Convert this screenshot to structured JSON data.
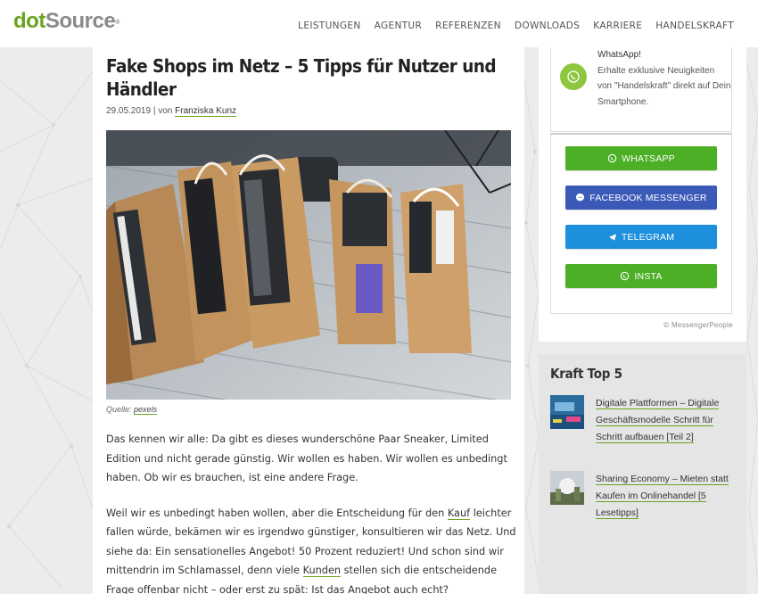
{
  "header": {
    "logo_part1": "dot",
    "logo_part2": "Source",
    "nav": [
      "LEISTUNGEN",
      "AGENTUR",
      "REFERENZEN",
      "DOWNLOADS",
      "KARRIERE",
      "HANDELSKRAFT"
    ]
  },
  "article": {
    "title": "Fake Shops im Netz – 5 Tipps für Nutzer und Händler",
    "date": "29.05.2019",
    "by": "| von",
    "author": "Franziska Kunz",
    "caption_prefix": "Quelle:",
    "caption_link": "pexels",
    "p1": "Das kennen wir alle: Da gibt es dieses wunderschöne Paar Sneaker, Limited Edition und nicht gerade günstig. Wir wollen es haben. Wir wollen es unbedingt haben. Ob wir es brauchen, ist eine andere Frage.",
    "p2_a": "Weil wir es unbedingt haben wollen, aber die Entscheidung für den ",
    "p2_link1": "Kauf",
    "p2_b": " leichter fallen würde, bekämen wir es irgendwo günstiger, konsultieren wir das Netz. Und siehe da: Ein sensationelles Angebot! 50 Prozent reduziert! Und schon sind wir mittendrin im Schlamassel, denn viele ",
    "p2_link2": "Kunden",
    "p2_c": " stellen sich die entscheidende Frage offenbar nicht – oder erst zu spät: Ist das Angebot auch echt?"
  },
  "widget": {
    "line1": "WhatsApp!",
    "line2": "Erhalte exklusive Neuigkeiten von \"Handelskraft\" direkt auf Dein Smartphone.",
    "buttons": [
      {
        "label": "WHATSAPP",
        "color": "#4caf25",
        "icon": "whatsapp-icon"
      },
      {
        "label": "FACEBOOK MESSENGER",
        "color": "#3b5ab8",
        "icon": "messenger-icon"
      },
      {
        "label": "TELEGRAM",
        "color": "#1e8fdc",
        "icon": "telegram-icon"
      },
      {
        "label": "INSTA",
        "color": "#4caf25",
        "icon": "whatsapp-icon"
      }
    ],
    "credit": "© MessengerPeople"
  },
  "kraft": {
    "title": "Kraft Top 5",
    "items": [
      {
        "title": "Digitale Plattformen – Digitale Geschäftsmodelle Schritt für Schritt aufbauen [Teil 2]"
      },
      {
        "title": "Sharing Economy – Mieten statt Kaufen im Onlinehandel [5 Lesetipps]"
      }
    ]
  },
  "colors": {
    "brand_green": "#6aa31d",
    "background": "#ececec"
  }
}
